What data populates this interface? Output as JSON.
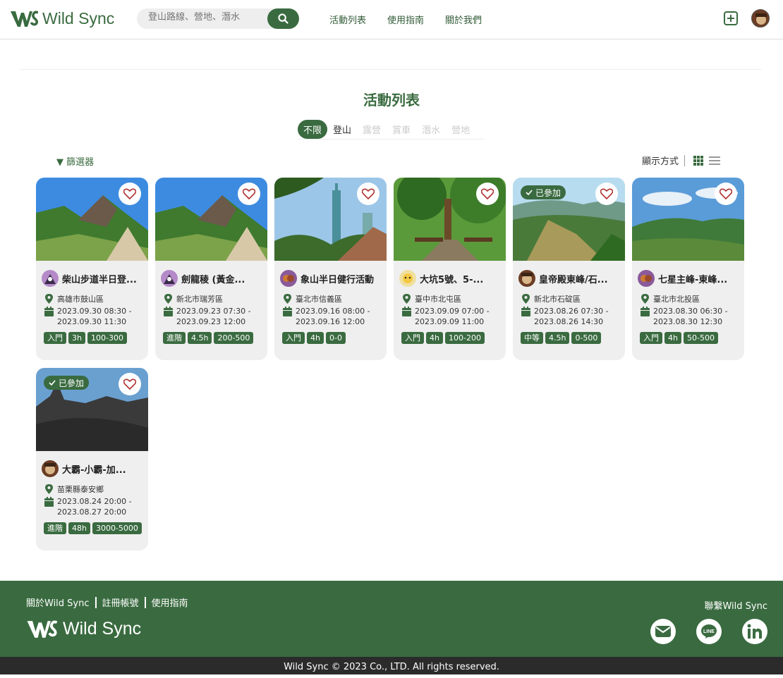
{
  "header": {
    "brand": "Wild Sync",
    "search_placeholder": "登山路線、營地、潛水",
    "nav": [
      "活動列表",
      "使用指南",
      "關於我們"
    ]
  },
  "page": {
    "title": "活動列表",
    "categories": [
      "不限",
      "登山",
      "露營",
      "賞車",
      "潛水",
      "營地"
    ],
    "filter_label": "▼ 篩選器",
    "view_label": "顯示方式"
  },
  "cards": [
    {
      "name": "柴山步道半日登...",
      "location": "高雄市鼓山區",
      "date1": "2023.09.30 08:30 -",
      "date2": "2023.09.30 11:30",
      "tags": [
        "入門",
        "3h",
        "100-300"
      ],
      "joined": ""
    },
    {
      "name": "劍龍稜 (黃金...",
      "location": "新北市瑞芳區",
      "date1": "2023.09.23 07:30 -",
      "date2": "2023.09.23 12:00",
      "tags": [
        "進階",
        "4.5h",
        "200-500"
      ],
      "joined": ""
    },
    {
      "name": "象山半日健行活動",
      "location": "臺北市信義區",
      "date1": "2023.09.16 08:00 -",
      "date2": "2023.09.16 12:00",
      "tags": [
        "入門",
        "4h",
        "0-0"
      ],
      "joined": ""
    },
    {
      "name": "大坑5號、5-...",
      "location": "臺中市北屯區",
      "date1": "2023.09.09 07:00 -",
      "date2": "2023.09.09 11:00",
      "tags": [
        "入門",
        "4h",
        "100-200"
      ],
      "joined": ""
    },
    {
      "name": "皇帝殿東峰/石...",
      "location": "新北市石碇區",
      "date1": "2023.08.26 07:30 -",
      "date2": "2023.08.26 14:30",
      "tags": [
        "中等",
        "4.5h",
        "0-500"
      ],
      "joined": "已參加"
    },
    {
      "name": "七星主峰-東峰...",
      "location": "臺北市北投區",
      "date1": "2023.08.30 06:30 -",
      "date2": "2023.08.30 12:30",
      "tags": [
        "入門",
        "4h",
        "50-500"
      ],
      "joined": ""
    },
    {
      "name": "大霸-小霸-加...",
      "location": "苗栗縣泰安鄉",
      "date1": "2023.08.24 20:00 -",
      "date2": "2023.08.27 20:00",
      "tags": [
        "進階",
        "48h",
        "3000-5000"
      ],
      "joined": "已參加"
    }
  ],
  "footer": {
    "links": [
      "關於Wild Sync",
      "註冊帳號",
      "使用指南"
    ],
    "brand": "Wild Sync",
    "contact": "聯繫Wild Sync",
    "copyright": "Wild Sync © 2023 Co., LTD. All rights reserved."
  },
  "colors": {
    "brand": "#3a6b40",
    "footer_bottom": "#2b2b2b",
    "card_bg": "#efefef"
  }
}
